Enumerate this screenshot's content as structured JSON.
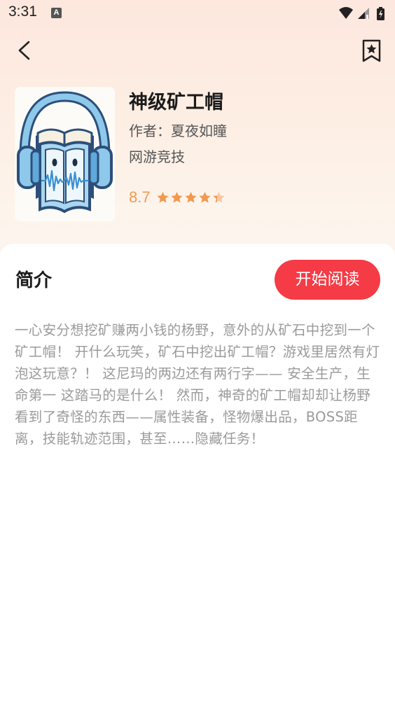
{
  "status_bar": {
    "time": "3:31",
    "notification_badge": "A",
    "icons": [
      "wifi-icon",
      "cellular-signal-icon",
      "battery-icon"
    ]
  },
  "header": {
    "back_icon": "chevron-left-icon",
    "bookmark_icon": "bookmark-star-icon"
  },
  "book": {
    "cover_icon": "audiobook-headphones-icon",
    "title": "神级矿工帽",
    "author": "作者：夏夜如瞳",
    "genre": "网游竞技",
    "rating_score": "8.7",
    "rating_stars": 4.35,
    "rating_max": 5
  },
  "intro": {
    "heading": "简介",
    "read_button_label": "开始阅读",
    "text": "一心安分想挖矿赚两小钱的杨野，意外的从矿石中挖到一个矿工帽！ 开什么玩笑，矿石中挖出矿工帽？游戏里居然有灯泡这玩意？！ 这尼玛的两边还有两行字—— 安全生产，生命第一 这踏马的是什么！ 然而，神奇的矿工帽却却让杨野看到了奇怪的东西——属性装备，怪物爆出品，BOSS距离，技能轨迹范围，甚至……隐藏任务！"
  },
  "colors": {
    "accent": "#f43b46",
    "rating": "#f09a4d",
    "star_empty": "#f6c9a6"
  }
}
